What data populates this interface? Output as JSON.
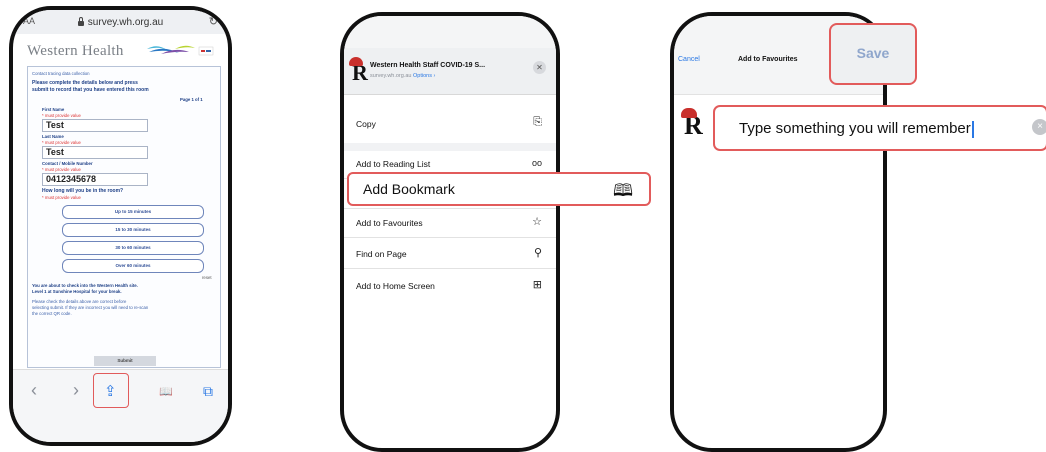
{
  "phone1": {
    "url_text": "survey.wh.org.au",
    "aa": "AA",
    "reload": "↻",
    "brand": "Western Health",
    "form": {
      "intro": "Contact tracing data collection",
      "instructions_1": "Please complete the details below and press",
      "instructions_2": "submit to record that you have entered this room",
      "page_indicator": "Page 1 of 1",
      "first_name_label": "First Name",
      "first_name_required": "* must provide value",
      "first_name_value": "Test",
      "last_name_label": "Last Name",
      "last_name_required": "* must provide value",
      "last_name_value": "Test",
      "contact_label": "Contact / Mobile Number",
      "contact_required": "* must provide value",
      "contact_value": "0412345678",
      "duration_question": "How long will you be in the room?",
      "duration_required": "* must provide value",
      "duration_options": [
        "Up to 15 minutes",
        "15 to 30 minutes",
        "30 to 60 minutes",
        "Over 60 minutes"
      ],
      "reset": "reset",
      "note_1": "You are about to check into the Western Health site.",
      "note_2": "Level 1 at Sunshine Hospital for your break.",
      "note_3": "Please check the details above are correct before",
      "note_4": "selecting submit. If they are incorrect you will need to re-scan",
      "note_5": "the correct QR code.",
      "submit": "Submit"
    },
    "toolbar": {
      "back": "‹",
      "forward": "›",
      "share": "⇪",
      "bookmarks": "📖",
      "tabs": "⧉"
    }
  },
  "phone2": {
    "card_title": "Western Health Staff COVID-19 S...",
    "card_domain": "survey.wh.org.au",
    "card_options": "Options ›",
    "close": "✕",
    "menu": [
      {
        "label": "Copy",
        "icon": "⎘"
      },
      {
        "label": "Add to Reading List",
        "icon": "oo"
      },
      {
        "label": "Add Bookmark",
        "icon": "🕮"
      },
      {
        "label": "Add to Favourites",
        "icon": "☆"
      },
      {
        "label": "Find on Page",
        "icon": "⚲"
      },
      {
        "label": "Add to Home Screen",
        "icon": "⊞"
      }
    ]
  },
  "phone3": {
    "cancel": "Cancel",
    "title": "Add to Favourites",
    "save": "Save",
    "input_value": "Type something you will remember",
    "clear": "×"
  },
  "colors": {
    "highlight": "#e25b5b",
    "ios_blue": "#2a78e4"
  }
}
